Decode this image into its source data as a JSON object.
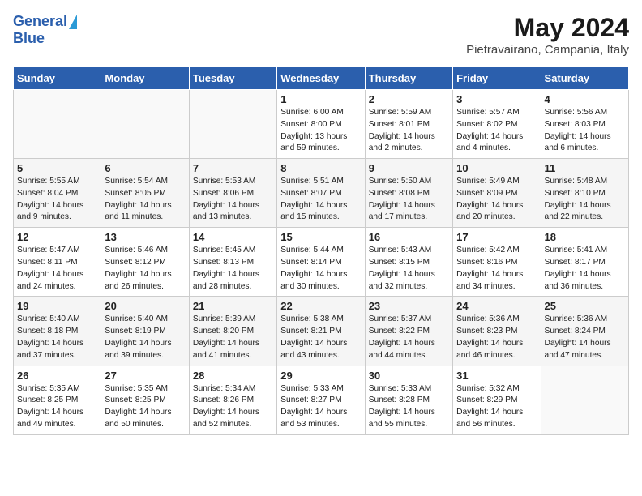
{
  "logo": {
    "general": "General",
    "blue": "Blue"
  },
  "title": "May 2024",
  "subtitle": "Pietravairano, Campania, Italy",
  "headers": [
    "Sunday",
    "Monday",
    "Tuesday",
    "Wednesday",
    "Thursday",
    "Friday",
    "Saturday"
  ],
  "weeks": [
    [
      {
        "day": "",
        "sunrise": "",
        "sunset": "",
        "daylight": ""
      },
      {
        "day": "",
        "sunrise": "",
        "sunset": "",
        "daylight": ""
      },
      {
        "day": "",
        "sunrise": "",
        "sunset": "",
        "daylight": ""
      },
      {
        "day": "1",
        "sunrise": "Sunrise: 6:00 AM",
        "sunset": "Sunset: 8:00 PM",
        "daylight": "Daylight: 13 hours and 59 minutes."
      },
      {
        "day": "2",
        "sunrise": "Sunrise: 5:59 AM",
        "sunset": "Sunset: 8:01 PM",
        "daylight": "Daylight: 14 hours and 2 minutes."
      },
      {
        "day": "3",
        "sunrise": "Sunrise: 5:57 AM",
        "sunset": "Sunset: 8:02 PM",
        "daylight": "Daylight: 14 hours and 4 minutes."
      },
      {
        "day": "4",
        "sunrise": "Sunrise: 5:56 AM",
        "sunset": "Sunset: 8:03 PM",
        "daylight": "Daylight: 14 hours and 6 minutes."
      }
    ],
    [
      {
        "day": "5",
        "sunrise": "Sunrise: 5:55 AM",
        "sunset": "Sunset: 8:04 PM",
        "daylight": "Daylight: 14 hours and 9 minutes."
      },
      {
        "day": "6",
        "sunrise": "Sunrise: 5:54 AM",
        "sunset": "Sunset: 8:05 PM",
        "daylight": "Daylight: 14 hours and 11 minutes."
      },
      {
        "day": "7",
        "sunrise": "Sunrise: 5:53 AM",
        "sunset": "Sunset: 8:06 PM",
        "daylight": "Daylight: 14 hours and 13 minutes."
      },
      {
        "day": "8",
        "sunrise": "Sunrise: 5:51 AM",
        "sunset": "Sunset: 8:07 PM",
        "daylight": "Daylight: 14 hours and 15 minutes."
      },
      {
        "day": "9",
        "sunrise": "Sunrise: 5:50 AM",
        "sunset": "Sunset: 8:08 PM",
        "daylight": "Daylight: 14 hours and 17 minutes."
      },
      {
        "day": "10",
        "sunrise": "Sunrise: 5:49 AM",
        "sunset": "Sunset: 8:09 PM",
        "daylight": "Daylight: 14 hours and 20 minutes."
      },
      {
        "day": "11",
        "sunrise": "Sunrise: 5:48 AM",
        "sunset": "Sunset: 8:10 PM",
        "daylight": "Daylight: 14 hours and 22 minutes."
      }
    ],
    [
      {
        "day": "12",
        "sunrise": "Sunrise: 5:47 AM",
        "sunset": "Sunset: 8:11 PM",
        "daylight": "Daylight: 14 hours and 24 minutes."
      },
      {
        "day": "13",
        "sunrise": "Sunrise: 5:46 AM",
        "sunset": "Sunset: 8:12 PM",
        "daylight": "Daylight: 14 hours and 26 minutes."
      },
      {
        "day": "14",
        "sunrise": "Sunrise: 5:45 AM",
        "sunset": "Sunset: 8:13 PM",
        "daylight": "Daylight: 14 hours and 28 minutes."
      },
      {
        "day": "15",
        "sunrise": "Sunrise: 5:44 AM",
        "sunset": "Sunset: 8:14 PM",
        "daylight": "Daylight: 14 hours and 30 minutes."
      },
      {
        "day": "16",
        "sunrise": "Sunrise: 5:43 AM",
        "sunset": "Sunset: 8:15 PM",
        "daylight": "Daylight: 14 hours and 32 minutes."
      },
      {
        "day": "17",
        "sunrise": "Sunrise: 5:42 AM",
        "sunset": "Sunset: 8:16 PM",
        "daylight": "Daylight: 14 hours and 34 minutes."
      },
      {
        "day": "18",
        "sunrise": "Sunrise: 5:41 AM",
        "sunset": "Sunset: 8:17 PM",
        "daylight": "Daylight: 14 hours and 36 minutes."
      }
    ],
    [
      {
        "day": "19",
        "sunrise": "Sunrise: 5:40 AM",
        "sunset": "Sunset: 8:18 PM",
        "daylight": "Daylight: 14 hours and 37 minutes."
      },
      {
        "day": "20",
        "sunrise": "Sunrise: 5:40 AM",
        "sunset": "Sunset: 8:19 PM",
        "daylight": "Daylight: 14 hours and 39 minutes."
      },
      {
        "day": "21",
        "sunrise": "Sunrise: 5:39 AM",
        "sunset": "Sunset: 8:20 PM",
        "daylight": "Daylight: 14 hours and 41 minutes."
      },
      {
        "day": "22",
        "sunrise": "Sunrise: 5:38 AM",
        "sunset": "Sunset: 8:21 PM",
        "daylight": "Daylight: 14 hours and 43 minutes."
      },
      {
        "day": "23",
        "sunrise": "Sunrise: 5:37 AM",
        "sunset": "Sunset: 8:22 PM",
        "daylight": "Daylight: 14 hours and 44 minutes."
      },
      {
        "day": "24",
        "sunrise": "Sunrise: 5:36 AM",
        "sunset": "Sunset: 8:23 PM",
        "daylight": "Daylight: 14 hours and 46 minutes."
      },
      {
        "day": "25",
        "sunrise": "Sunrise: 5:36 AM",
        "sunset": "Sunset: 8:24 PM",
        "daylight": "Daylight: 14 hours and 47 minutes."
      }
    ],
    [
      {
        "day": "26",
        "sunrise": "Sunrise: 5:35 AM",
        "sunset": "Sunset: 8:25 PM",
        "daylight": "Daylight: 14 hours and 49 minutes."
      },
      {
        "day": "27",
        "sunrise": "Sunrise: 5:35 AM",
        "sunset": "Sunset: 8:25 PM",
        "daylight": "Daylight: 14 hours and 50 minutes."
      },
      {
        "day": "28",
        "sunrise": "Sunrise: 5:34 AM",
        "sunset": "Sunset: 8:26 PM",
        "daylight": "Daylight: 14 hours and 52 minutes."
      },
      {
        "day": "29",
        "sunrise": "Sunrise: 5:33 AM",
        "sunset": "Sunset: 8:27 PM",
        "daylight": "Daylight: 14 hours and 53 minutes."
      },
      {
        "day": "30",
        "sunrise": "Sunrise: 5:33 AM",
        "sunset": "Sunset: 8:28 PM",
        "daylight": "Daylight: 14 hours and 55 minutes."
      },
      {
        "day": "31",
        "sunrise": "Sunrise: 5:32 AM",
        "sunset": "Sunset: 8:29 PM",
        "daylight": "Daylight: 14 hours and 56 minutes."
      },
      {
        "day": "",
        "sunrise": "",
        "sunset": "",
        "daylight": ""
      }
    ]
  ]
}
